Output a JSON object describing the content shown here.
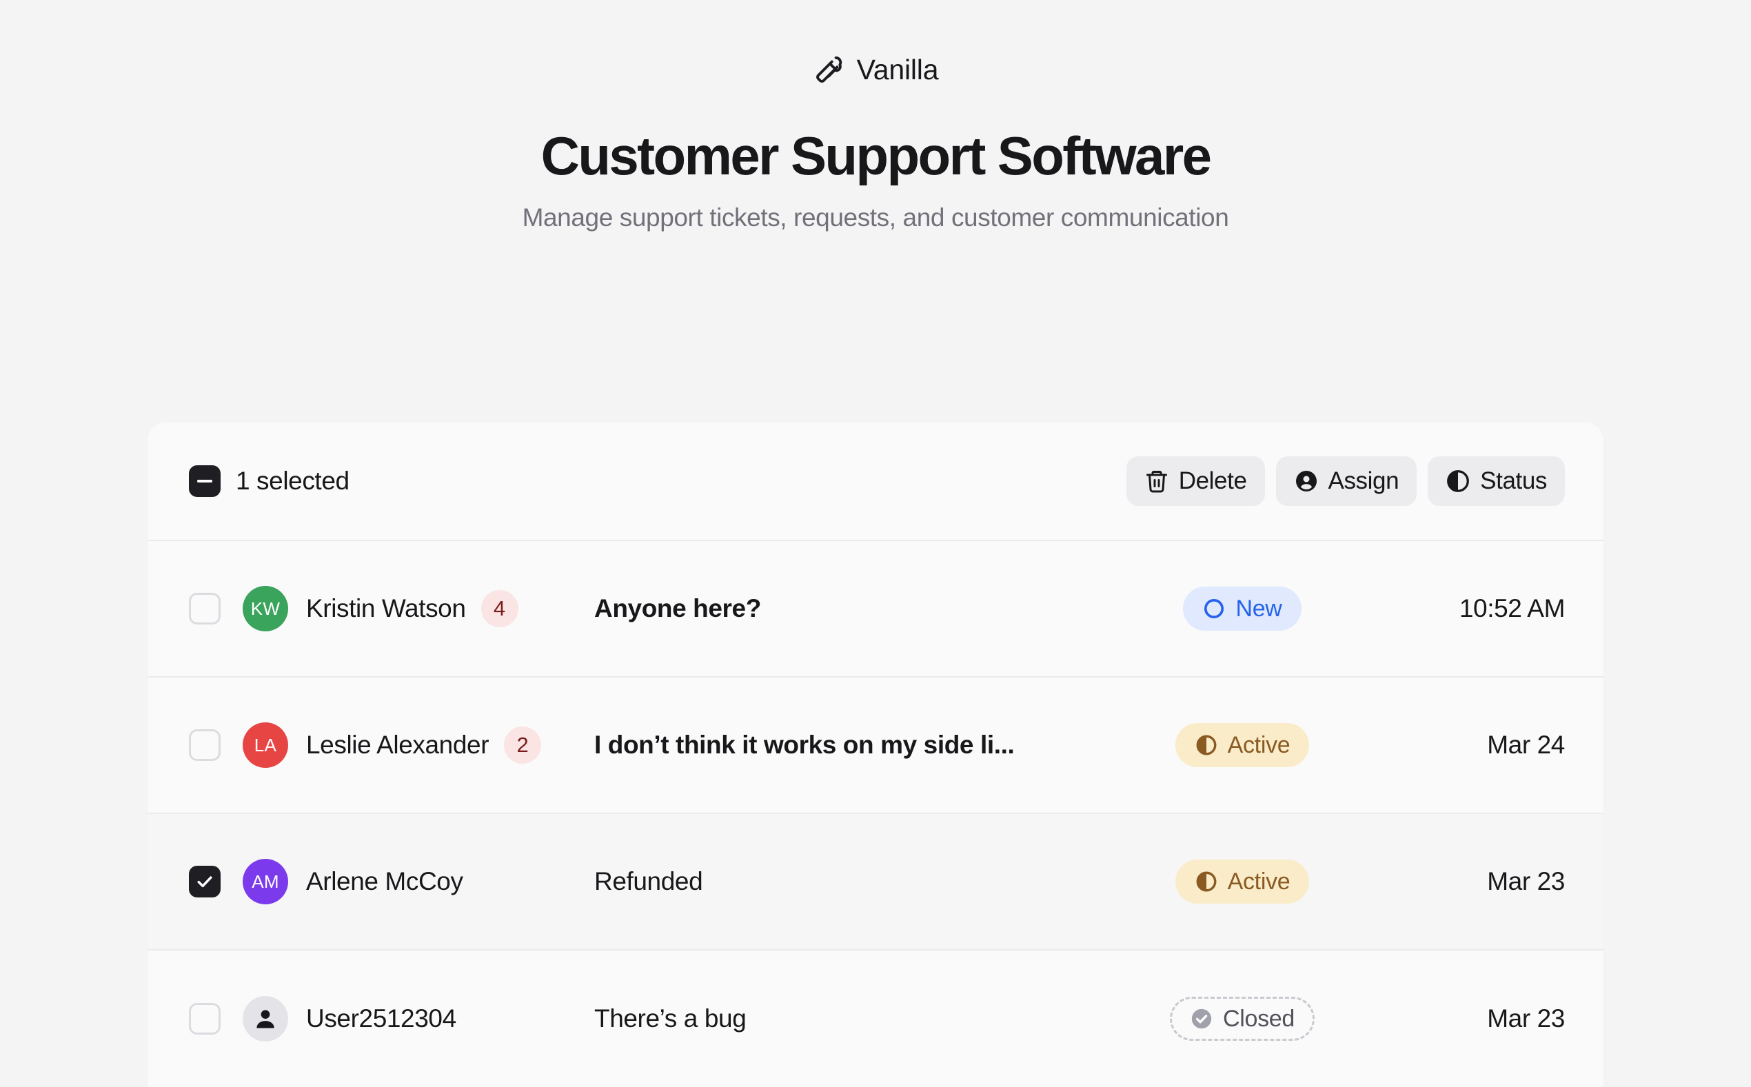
{
  "brand": {
    "name": "Vanilla",
    "icon": "ice-cream-cone-icon"
  },
  "header": {
    "title": "Customer Support Software",
    "subtitle": "Manage support tickets, requests, and customer communication"
  },
  "toolbar": {
    "selection_state": "indeterminate",
    "selected_label": "1 selected",
    "actions": [
      {
        "label": "Delete",
        "icon": "trash-icon"
      },
      {
        "label": "Assign",
        "icon": "user-circle-icon"
      },
      {
        "label": "Status",
        "icon": "half-circle-icon"
      }
    ]
  },
  "rows": [
    {
      "checked": false,
      "avatar": {
        "initials": "KW",
        "color": "#3aa35c",
        "type": "initials"
      },
      "name": "Kristin Watson",
      "count": "4",
      "message": "Anyone here?",
      "message_bold": true,
      "status": {
        "label": "New",
        "kind": "new",
        "icon": "circle-outline-icon"
      },
      "time": "10:52 AM"
    },
    {
      "checked": false,
      "avatar": {
        "initials": "LA",
        "color": "#e74444",
        "type": "initials"
      },
      "name": "Leslie Alexander",
      "count": "2",
      "message": "I don’t think it works on my side li...",
      "message_bold": true,
      "status": {
        "label": "Active",
        "kind": "active",
        "icon": "half-circle-icon"
      },
      "time": "Mar 24"
    },
    {
      "checked": true,
      "avatar": {
        "initials": "AM",
        "color": "#7c3aed",
        "type": "initials"
      },
      "name": "Arlene McCoy",
      "count": "",
      "message": "Refunded",
      "message_bold": false,
      "status": {
        "label": "Active",
        "kind": "active",
        "icon": "half-circle-icon"
      },
      "time": "Mar 23"
    },
    {
      "checked": false,
      "avatar": {
        "initials": "",
        "color": "#e4e4e8",
        "type": "anon"
      },
      "name": "User2512304",
      "count": "",
      "message": "There’s a bug",
      "message_bold": false,
      "status": {
        "label": "Closed",
        "kind": "closed",
        "icon": "check-circle-icon"
      },
      "time": "Mar 23"
    }
  ],
  "colors": {
    "page_background": "#f4f4f5",
    "card_background": "#fafafa",
    "divider": "#ebebee",
    "accent_new": "#2563eb",
    "accent_active": "#8a5a23",
    "accent_closed": "#52525b",
    "count_badge_bg": "#fbe4e4",
    "count_badge_fg": "#7c1d1d"
  }
}
